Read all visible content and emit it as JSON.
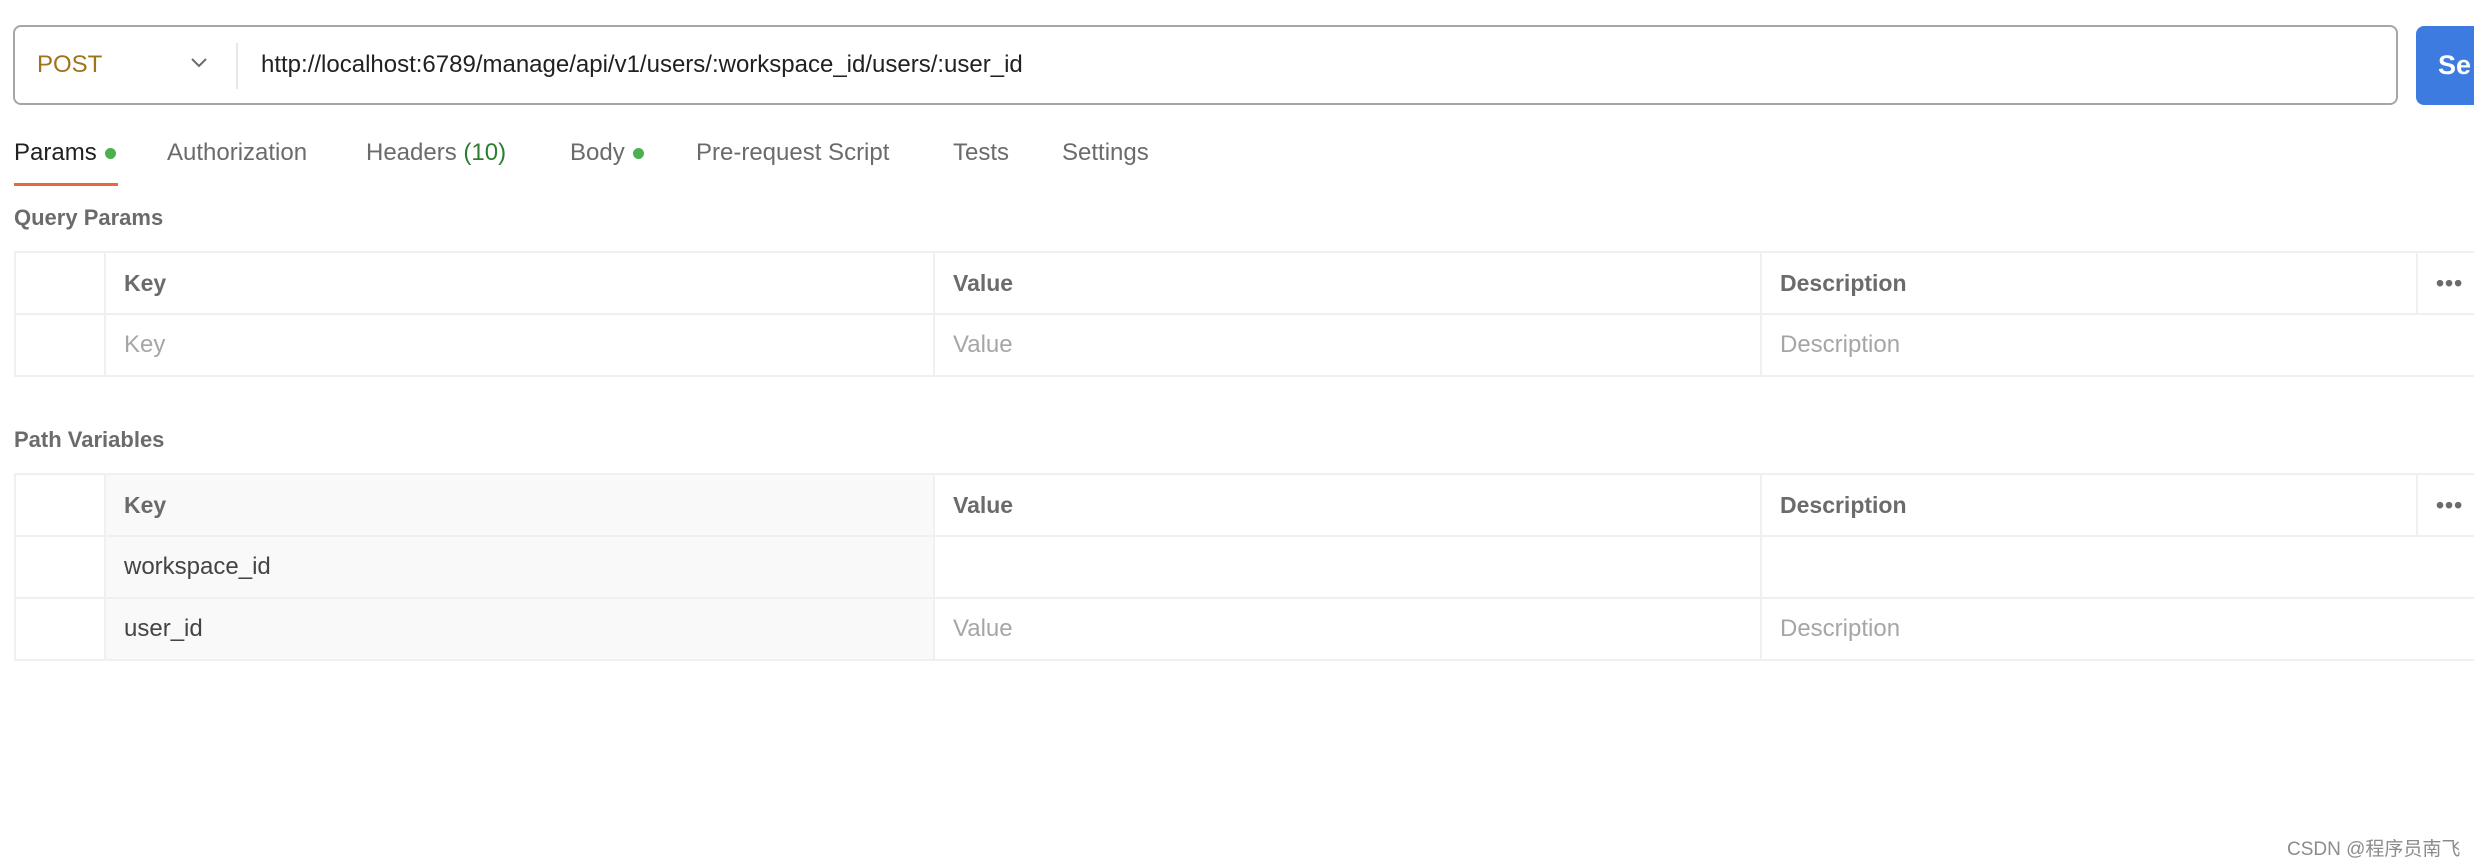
{
  "request": {
    "method": "POST",
    "url": "http://localhost:6789/manage/api/v1/users/:workspace_id/users/:user_id",
    "send_label": "Se"
  },
  "tabs": [
    {
      "label": "Params",
      "dot": true,
      "active": true
    },
    {
      "label": "Authorization"
    },
    {
      "label": "Headers",
      "count": "(10)"
    },
    {
      "label": "Body",
      "dot": true
    },
    {
      "label": "Pre-request Script"
    },
    {
      "label": "Tests"
    },
    {
      "label": "Settings"
    }
  ],
  "query_params": {
    "title": "Query Params",
    "columns": [
      "Key",
      "Value",
      "Description"
    ],
    "placeholder_row": [
      "Key",
      "Value",
      "Description"
    ]
  },
  "path_variables": {
    "title": "Path Variables",
    "columns": [
      "Key",
      "Value",
      "Description"
    ],
    "rows": [
      {
        "key": "workspace_id",
        "value": "",
        "description": ""
      },
      {
        "key": "user_id",
        "value_placeholder": "Value",
        "description_placeholder": "Description"
      }
    ]
  },
  "more_icon": "ellipsis-icon",
  "watermark": "CSDN @程序员南飞",
  "colors": {
    "send": "#3d7be0",
    "method": "#a0741c",
    "active_underline": "#e8693f",
    "dot": "#4caf50"
  }
}
